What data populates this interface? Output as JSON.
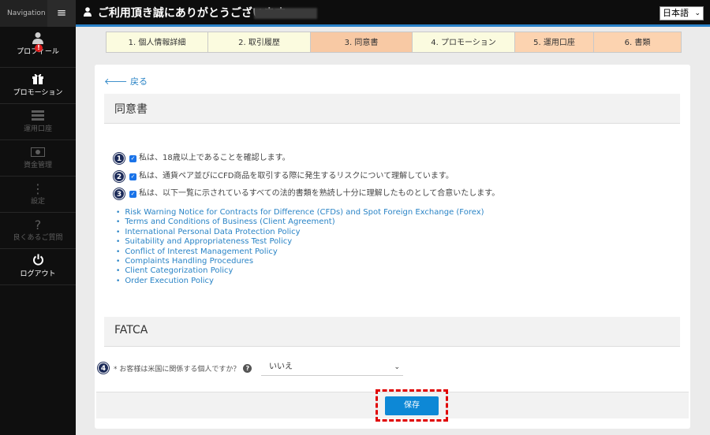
{
  "nav": {
    "label": "Navigation",
    "toggle": "≡",
    "items": [
      {
        "label": "プロフィール",
        "icon": "user-icon",
        "glyph": "👤"
      },
      {
        "label": "プロモーション",
        "icon": "gift-icon",
        "glyph": "🎁"
      },
      {
        "label": "運用口座",
        "icon": "accounts-icon",
        "glyph": "☰"
      },
      {
        "label": "資金管理",
        "icon": "money-icon",
        "glyph": "💵"
      },
      {
        "label": "設定",
        "icon": "settings-icon",
        "glyph": "⋮"
      },
      {
        "label": "良くあるご質問",
        "icon": "question-icon",
        "glyph": "?"
      },
      {
        "label": "ログアウト",
        "icon": "power-icon",
        "glyph": "⏻"
      }
    ],
    "alert": "!"
  },
  "header": {
    "user_glyph": "👤",
    "welcome": "ご利用頂き誠にありがとうございます",
    "language": "日本語",
    "chevron": "⌄"
  },
  "steps": [
    {
      "label": "1.  個人情報詳細",
      "state": "done"
    },
    {
      "label": "2.  取引履歴",
      "state": "done"
    },
    {
      "label": "3.  同意書",
      "state": "current"
    },
    {
      "label": "4.  プロモーション",
      "state": "done"
    },
    {
      "label": "5.  運用口座",
      "state": "todo"
    },
    {
      "label": "6.  書類",
      "state": "todo"
    }
  ],
  "back": "🡐 戻る",
  "consent": {
    "title": "同意書",
    "items": [
      {
        "number": "1",
        "check": "✓",
        "text": "私は、18歳以上であることを確認します。"
      },
      {
        "number": "2",
        "check": "✓",
        "text": "私は、通貨ペア並びにCFD商品を取引する際に発生するリスクについて理解しています。"
      },
      {
        "number": "3",
        "check": "✓",
        "text": "私は、以下一覧に示されているすべての法的書類を熟読し十分に理解したものとして合意いたします。"
      }
    ],
    "documents": [
      "Risk Warning Notice for Contracts for Difference (CFDs) and Spot Foreign Exchange (Forex)",
      "Terms and Conditions of Business (Client Agreement)",
      "International Personal Data Protection Policy",
      "Suitability and Appropriateness Test Policy",
      "Conflict of Interest Management Policy",
      "Complaints Handling Procedures",
      "Client Categorization Policy",
      "Order Execution Policy"
    ]
  },
  "fatca": {
    "title": "FATCA",
    "number": "4",
    "question": "* お客様は米国に関係する個人ですか？",
    "help": "?",
    "value": "いいえ",
    "chevron": "⌄"
  },
  "save_label": "保存",
  "colors": {
    "accent": "#0d88d6",
    "link": "#2a84c6",
    "badge": "#1c2b59",
    "highlight": "#e00000"
  }
}
